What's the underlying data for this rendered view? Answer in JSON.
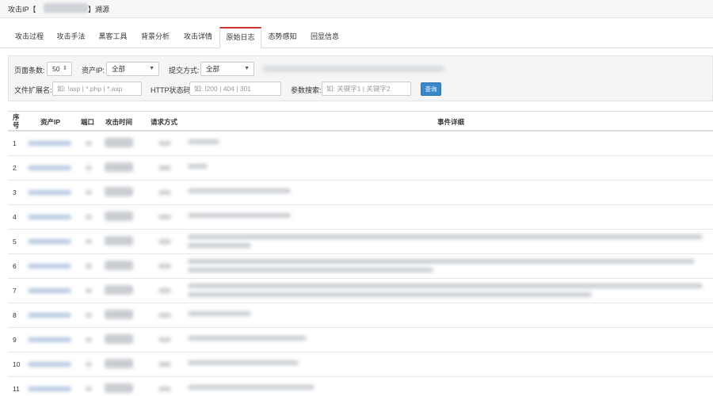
{
  "header": {
    "prefix": "攻击IP【",
    "bracket_close": "】",
    "suffix": "溯源"
  },
  "tabs": [
    "攻击过程",
    "攻击手法",
    "黑客工具",
    "背景分析",
    "攻击详情",
    "原始日志",
    "态势感知",
    "回显信息"
  ],
  "active_tab": "原始日志",
  "accent_color": "#c9302c",
  "filters": {
    "page_size_label": "页面条数:",
    "page_size_value": "50",
    "asset_ip_label": "资产IP:",
    "asset_ip_value": "全部",
    "method_label": "提交方式:",
    "method_value": "全部",
    "ext_label": "文件扩展名:",
    "ext_placeholder": "如: !asp | *.php | *.asp",
    "http_label": "HTTP状态码:",
    "http_placeholder": "如: !200 | 404 | 301",
    "param_label": "参数搜索:",
    "param_placeholder": "如: 关键字1 | 关键字2",
    "query_button": "查询"
  },
  "table": {
    "columns": [
      "序号",
      "资产IP",
      "端口",
      "攻击时间",
      "请求方式",
      "事件详细"
    ],
    "rows": [
      "1",
      "2",
      "3",
      "4",
      "5",
      "6",
      "7",
      "8",
      "9",
      "10",
      "11"
    ]
  }
}
